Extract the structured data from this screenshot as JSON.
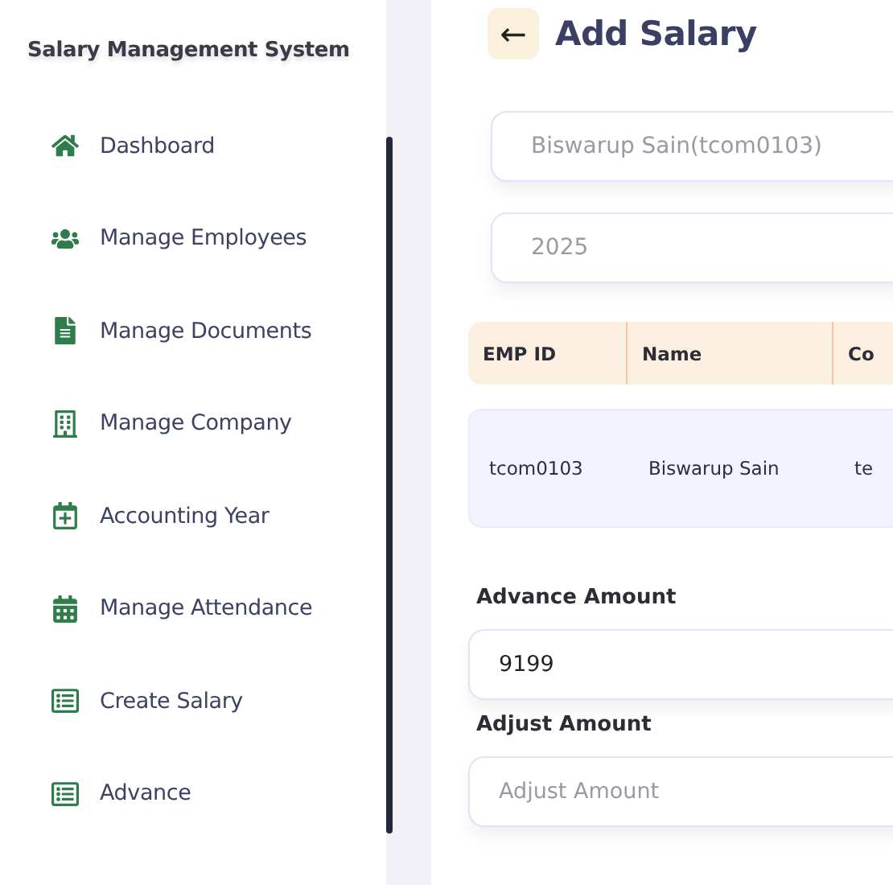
{
  "sidebar": {
    "title": "Salary Management System",
    "items": [
      {
        "kind": "home",
        "label": "Dashboard"
      },
      {
        "kind": "users",
        "label": "Manage Employees"
      },
      {
        "kind": "document",
        "label": "Manage Documents"
      },
      {
        "kind": "building",
        "label": "Manage Company"
      },
      {
        "kind": "calendar-plus",
        "label": "Accounting Year"
      },
      {
        "kind": "calendar",
        "label": "Manage Attendance"
      },
      {
        "kind": "list",
        "label": "Create Salary"
      },
      {
        "kind": "list",
        "label": "Advance"
      }
    ]
  },
  "page": {
    "back_button": "←",
    "title": "Add Salary"
  },
  "selects": [
    {
      "placeholder": "Biswarup Sain(tcom0103)"
    },
    {
      "placeholder": "2025"
    }
  ],
  "table": {
    "columns": [
      "EMP ID",
      "Name",
      "Co"
    ],
    "rows": [
      [
        "tcom0103",
        "Biswarup Sain",
        "te"
      ]
    ]
  },
  "fields": [
    {
      "label": "Advance Amount",
      "value": "9199"
    },
    {
      "label": "Adjust Amount",
      "placeholder": "Adjust Amount"
    }
  ]
}
